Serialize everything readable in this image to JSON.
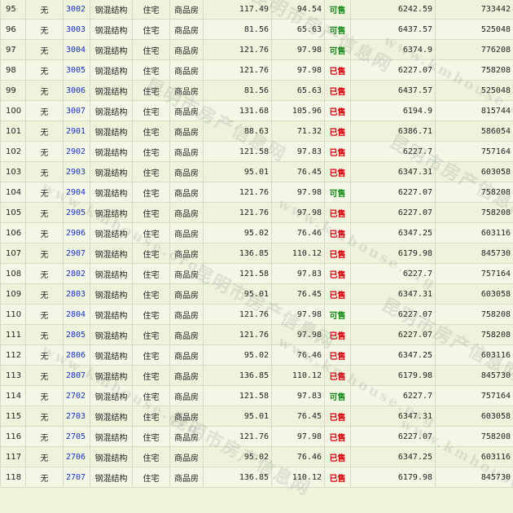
{
  "watermark": {
    "cn": "昆明市房产信息网",
    "en": "www.kmhouse.org"
  },
  "rows": [
    {
      "idx": "95",
      "none": "无",
      "room": "3002",
      "structure": "钢混结构",
      "usage": "住宅",
      "type": "商品房",
      "area": "117.49",
      "inner": "94.54",
      "status": "可售",
      "status_kind": "avail",
      "price": "6242.59",
      "total": "733442"
    },
    {
      "idx": "96",
      "none": "无",
      "room": "3003",
      "structure": "钢混结构",
      "usage": "住宅",
      "type": "商品房",
      "area": "81.56",
      "inner": "65.63",
      "status": "可售",
      "status_kind": "avail",
      "price": "6437.57",
      "total": "525048"
    },
    {
      "idx": "97",
      "none": "无",
      "room": "3004",
      "structure": "钢混结构",
      "usage": "住宅",
      "type": "商品房",
      "area": "121.76",
      "inner": "97.98",
      "status": "可售",
      "status_kind": "avail",
      "price": "6374.9",
      "total": "776208"
    },
    {
      "idx": "98",
      "none": "无",
      "room": "3005",
      "structure": "钢混结构",
      "usage": "住宅",
      "type": "商品房",
      "area": "121.76",
      "inner": "97.98",
      "status": "已售",
      "status_kind": "sold",
      "price": "6227.07",
      "total": "758208"
    },
    {
      "idx": "99",
      "none": "无",
      "room": "3006",
      "structure": "钢混结构",
      "usage": "住宅",
      "type": "商品房",
      "area": "81.56",
      "inner": "65.63",
      "status": "已售",
      "status_kind": "sold",
      "price": "6437.57",
      "total": "525048"
    },
    {
      "idx": "100",
      "none": "无",
      "room": "3007",
      "structure": "钢混结构",
      "usage": "住宅",
      "type": "商品房",
      "area": "131.68",
      "inner": "105.96",
      "status": "已售",
      "status_kind": "sold",
      "price": "6194.9",
      "total": "815744"
    },
    {
      "idx": "101",
      "none": "无",
      "room": "2901",
      "structure": "钢混结构",
      "usage": "住宅",
      "type": "商品房",
      "area": "88.63",
      "inner": "71.32",
      "status": "已售",
      "status_kind": "sold",
      "price": "6386.71",
      "total": "586054"
    },
    {
      "idx": "102",
      "none": "无",
      "room": "2902",
      "structure": "钢混结构",
      "usage": "住宅",
      "type": "商品房",
      "area": "121.58",
      "inner": "97.83",
      "status": "已售",
      "status_kind": "sold",
      "price": "6227.7",
      "total": "757164"
    },
    {
      "idx": "103",
      "none": "无",
      "room": "2903",
      "structure": "钢混结构",
      "usage": "住宅",
      "type": "商品房",
      "area": "95.01",
      "inner": "76.45",
      "status": "已售",
      "status_kind": "sold",
      "price": "6347.31",
      "total": "603058"
    },
    {
      "idx": "104",
      "none": "无",
      "room": "2904",
      "structure": "钢混结构",
      "usage": "住宅",
      "type": "商品房",
      "area": "121.76",
      "inner": "97.98",
      "status": "可售",
      "status_kind": "avail",
      "price": "6227.07",
      "total": "758208"
    },
    {
      "idx": "105",
      "none": "无",
      "room": "2905",
      "structure": "钢混结构",
      "usage": "住宅",
      "type": "商品房",
      "area": "121.76",
      "inner": "97.98",
      "status": "已售",
      "status_kind": "sold",
      "price": "6227.07",
      "total": "758208"
    },
    {
      "idx": "106",
      "none": "无",
      "room": "2906",
      "structure": "钢混结构",
      "usage": "住宅",
      "type": "商品房",
      "area": "95.02",
      "inner": "76.46",
      "status": "已售",
      "status_kind": "sold",
      "price": "6347.25",
      "total": "603116"
    },
    {
      "idx": "107",
      "none": "无",
      "room": "2907",
      "structure": "钢混结构",
      "usage": "住宅",
      "type": "商品房",
      "area": "136.85",
      "inner": "110.12",
      "status": "已售",
      "status_kind": "sold",
      "price": "6179.98",
      "total": "845730"
    },
    {
      "idx": "108",
      "none": "无",
      "room": "2802",
      "structure": "钢混结构",
      "usage": "住宅",
      "type": "商品房",
      "area": "121.58",
      "inner": "97.83",
      "status": "已售",
      "status_kind": "sold",
      "price": "6227.7",
      "total": "757164"
    },
    {
      "idx": "109",
      "none": "无",
      "room": "2803",
      "structure": "钢混结构",
      "usage": "住宅",
      "type": "商品房",
      "area": "95.01",
      "inner": "76.45",
      "status": "已售",
      "status_kind": "sold",
      "price": "6347.31",
      "total": "603058"
    },
    {
      "idx": "110",
      "none": "无",
      "room": "2804",
      "structure": "钢混结构",
      "usage": "住宅",
      "type": "商品房",
      "area": "121.76",
      "inner": "97.98",
      "status": "可售",
      "status_kind": "avail",
      "price": "6227.07",
      "total": "758208"
    },
    {
      "idx": "111",
      "none": "无",
      "room": "2805",
      "structure": "钢混结构",
      "usage": "住宅",
      "type": "商品房",
      "area": "121.76",
      "inner": "97.98",
      "status": "已售",
      "status_kind": "sold",
      "price": "6227.07",
      "total": "758208"
    },
    {
      "idx": "112",
      "none": "无",
      "room": "2806",
      "structure": "钢混结构",
      "usage": "住宅",
      "type": "商品房",
      "area": "95.02",
      "inner": "76.46",
      "status": "已售",
      "status_kind": "sold",
      "price": "6347.25",
      "total": "603116"
    },
    {
      "idx": "113",
      "none": "无",
      "room": "2807",
      "structure": "钢混结构",
      "usage": "住宅",
      "type": "商品房",
      "area": "136.85",
      "inner": "110.12",
      "status": "已售",
      "status_kind": "sold",
      "price": "6179.98",
      "total": "845730"
    },
    {
      "idx": "114",
      "none": "无",
      "room": "2702",
      "structure": "钢混结构",
      "usage": "住宅",
      "type": "商品房",
      "area": "121.58",
      "inner": "97.83",
      "status": "可售",
      "status_kind": "avail",
      "price": "6227.7",
      "total": "757164"
    },
    {
      "idx": "115",
      "none": "无",
      "room": "2703",
      "structure": "钢混结构",
      "usage": "住宅",
      "type": "商品房",
      "area": "95.01",
      "inner": "76.45",
      "status": "已售",
      "status_kind": "sold",
      "price": "6347.31",
      "total": "603058"
    },
    {
      "idx": "116",
      "none": "无",
      "room": "2705",
      "structure": "钢混结构",
      "usage": "住宅",
      "type": "商品房",
      "area": "121.76",
      "inner": "97.98",
      "status": "已售",
      "status_kind": "sold",
      "price": "6227.07",
      "total": "758208"
    },
    {
      "idx": "117",
      "none": "无",
      "room": "2706",
      "structure": "钢混结构",
      "usage": "住宅",
      "type": "商品房",
      "area": "95.02",
      "inner": "76.46",
      "status": "已售",
      "status_kind": "sold",
      "price": "6347.25",
      "total": "603116"
    },
    {
      "idx": "118",
      "none": "无",
      "room": "2707",
      "structure": "钢混结构",
      "usage": "住宅",
      "type": "商品房",
      "area": "136.85",
      "inner": "110.12",
      "status": "已售",
      "status_kind": "sold",
      "price": "6179.98",
      "total": "845730"
    }
  ]
}
